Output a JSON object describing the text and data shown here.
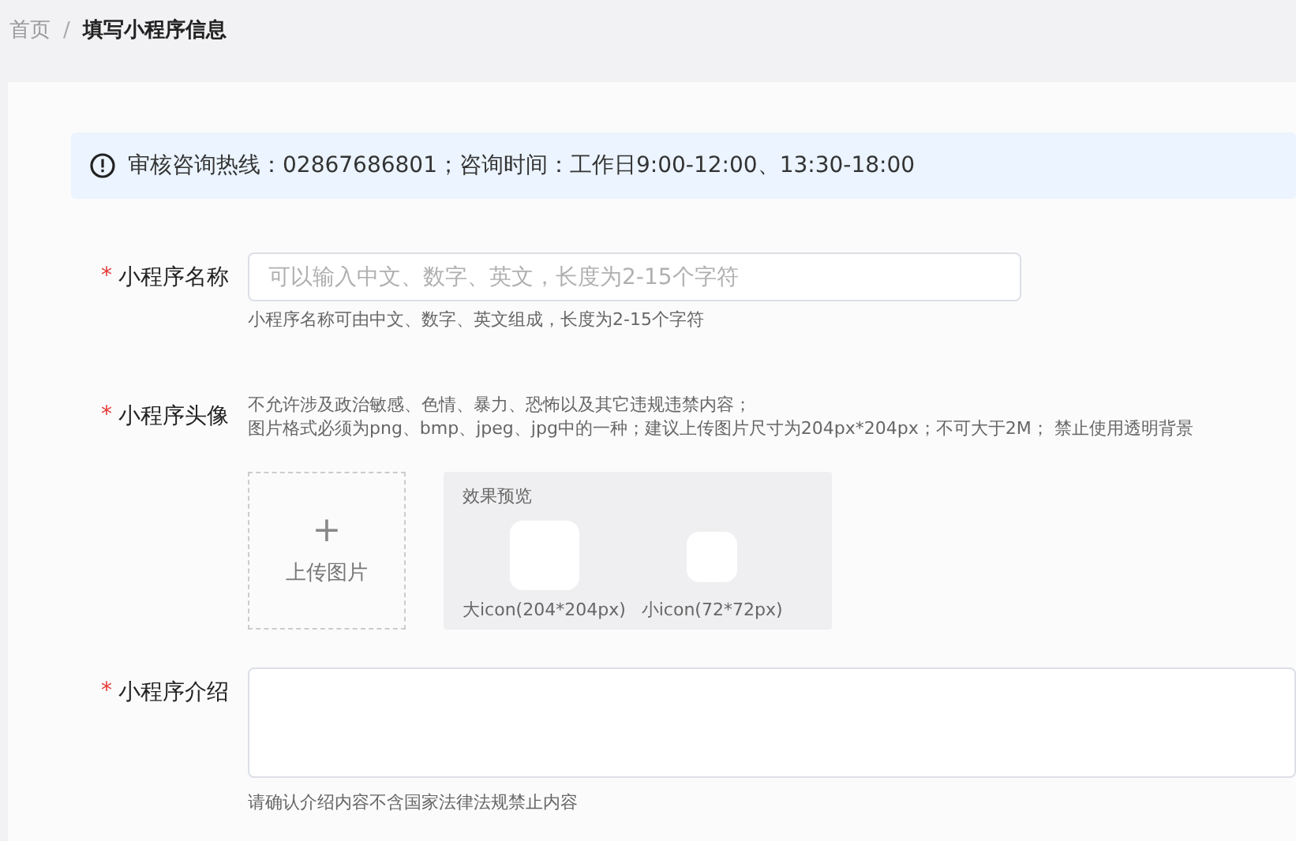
{
  "breadcrumb": {
    "separator": "/",
    "items": [
      {
        "label": "首页",
        "current": false
      },
      {
        "label": "填写小程序信息",
        "current": true
      }
    ]
  },
  "notice": {
    "text": "审核咨询热线：02867686801；咨询时间：工作日9:00-12:00、13:30-18:00"
  },
  "form": [
    {
      "kind": "text",
      "label": "小程序名称",
      "required_mark": "*",
      "placeholder": "可以输入中文、数字、英文，长度为2-15个字符",
      "hints": [
        "小程序名称可由中文、数字、英文组成，长度为2-15个字符"
      ]
    },
    {
      "kind": "upload",
      "label": "小程序头像",
      "required_mark": "*",
      "hints": [
        "不允许涉及政治敏感、色情、暴力、恐怖以及其它违规违禁内容；",
        "图片格式必须为png、bmp、jpeg、jpg中的一种；建议上传图片尺寸为204px*204px；不可大于2M； 禁止使用透明背景"
      ],
      "upload_plus": "+",
      "upload_label": "上传图片",
      "preview_title": "效果预览",
      "preview_large": "大icon(204*204px)",
      "preview_small": "小icon(72*72px)"
    },
    {
      "kind": "textarea",
      "label": "小程序介绍",
      "required_mark": "*",
      "hints": [
        "请确认介绍内容不含国家法律法规禁止内容"
      ]
    }
  ]
}
